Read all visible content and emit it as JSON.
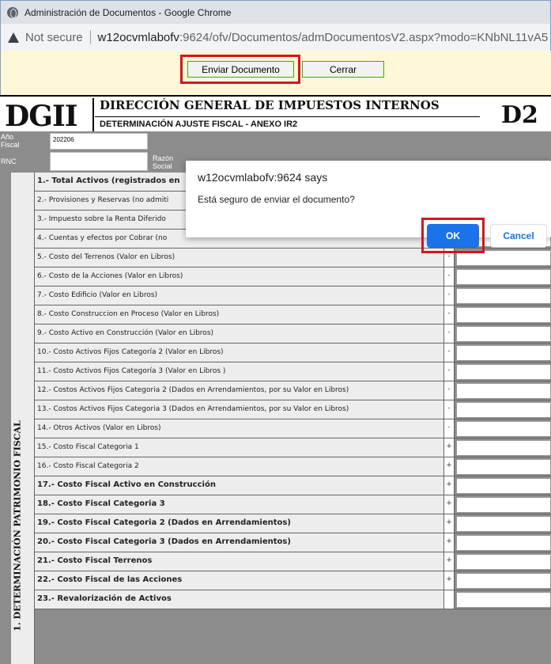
{
  "browser": {
    "window_title": "Administración de Documentos - Google Chrome",
    "security_label": "Not secure",
    "url_host": "w12ocvmlabofv",
    "url_rest": ":9624/ofv/Documentos/admDocumentosV2.aspx?modo=KNbNL11vA5"
  },
  "toolbar": {
    "send_label": "Enviar Documento",
    "close_label": "Cerrar"
  },
  "form": {
    "logo": "DGII",
    "title": "DIRECCIÓN GENERAL DE IMPUESTOS INTERNOS",
    "subtitle": "DETERMINACIÓN AJUSTE FISCAL - ANEXO IR2",
    "code": "D2",
    "year_label_1": "Año",
    "year_label_2": "Fiscal",
    "year_value": "202206",
    "rnc_label": "RNC",
    "razon_label_1": "Razón",
    "razon_label_2": "Social",
    "section_label": "1. DETERMINACIÓN PATRIMONIO FISCAL"
  },
  "rows": [
    {
      "label": "1.- Total Activos (registrados en",
      "sign": "",
      "bold": true
    },
    {
      "label": "2.- Provisiones y Reservas (no admiti",
      "sign": "",
      "bold": false
    },
    {
      "label": "3.- Impuesto sobre la Renta Diferido",
      "sign": "",
      "bold": false
    },
    {
      "label": "4.- Cuentas y efectos por Cobrar (no",
      "sign": "",
      "bold": false
    },
    {
      "label": "5.- Costo del Terrenos (Valor en Libros)",
      "sign": "-",
      "bold": false
    },
    {
      "label": "6.- Costo de la Acciones (Valor en Libros)",
      "sign": "-",
      "bold": false
    },
    {
      "label": "7.- Costo Edificio (Valor en Libros)",
      "sign": "-",
      "bold": false
    },
    {
      "label": "8.- Costo Construccion en Proceso (Valor en Libros)",
      "sign": "-",
      "bold": false
    },
    {
      "label": "9.- Costo Activo en Construcción (Valor en Libros)",
      "sign": "-",
      "bold": false
    },
    {
      "label": "10.- Costo Activos Fijos Categoría 2 (Valor en Libros)",
      "sign": "-",
      "bold": false
    },
    {
      "label": "11.- Costo Activos Fijos Categoría 3 (Valor en Libros )",
      "sign": "-",
      "bold": false
    },
    {
      "label": "12.- Costos Activos Fijos Categoria 2 (Dados en Arrendamientos, por su Valor en Libros)",
      "sign": "-",
      "bold": false
    },
    {
      "label": "13.- Costos Activos Fijos Categoria 3 (Dados en Arrendamientos, por su Valor en Libros)",
      "sign": "-",
      "bold": false
    },
    {
      "label": "14.- Otros Activos (Valor en Libros)",
      "sign": "-",
      "bold": false
    },
    {
      "label": "15.- Costo Fiscal Categoria 1",
      "sign": "+",
      "bold": false
    },
    {
      "label": "16.- Costo Fiscal Categoria 2",
      "sign": "+",
      "bold": false
    },
    {
      "label": "17.- Costo Fiscal Activo en Construcción",
      "sign": "+",
      "bold": true
    },
    {
      "label": "18.- Costo Fiscal Categoria 3",
      "sign": "+",
      "bold": true
    },
    {
      "label": "19.- Costo Fiscal Categoria 2 (Dados en Arrendamientos)",
      "sign": "+",
      "bold": true
    },
    {
      "label": "20.- Costo Fiscal Categoria 3 (Dados en Arrendamientos)",
      "sign": "+",
      "bold": true
    },
    {
      "label": "21.- Costo Fiscal Terrenos",
      "sign": "+",
      "bold": true
    },
    {
      "label": "22.- Costo Fiscal de las Acciones",
      "sign": "+",
      "bold": true
    },
    {
      "label": "23.- Revalorización de Activos",
      "sign": "",
      "bold": true
    }
  ],
  "dialog": {
    "title": "w12ocvmlabofv:9624 says",
    "message": "Está seguro de enviar el documento?",
    "ok_label": "OK",
    "cancel_label": "Cancel"
  },
  "colors": {
    "highlight": "#d41520",
    "ok_button": "#1a73e8",
    "toolbar_bg": "#fff8d8"
  }
}
